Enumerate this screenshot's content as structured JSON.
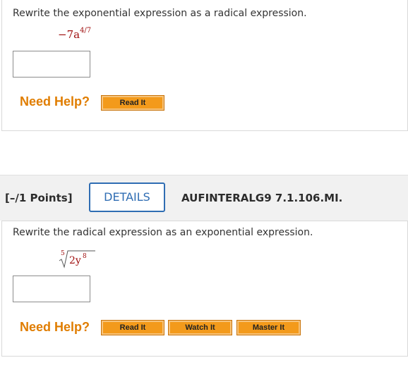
{
  "q1": {
    "prompt": "Rewrite the exponential expression as a radical expression.",
    "expression_base": "−7a",
    "expression_exp": "4/7",
    "need_help": "Need Help?",
    "buttons": [
      "Read It"
    ]
  },
  "q2_header": {
    "points": "[–/1 Points]",
    "details": "DETAILS",
    "code": "AUFINTERALG9 7.1.106.MI."
  },
  "q2": {
    "prompt": "Rewrite the radical expression as an exponential expression.",
    "radical_index": "5",
    "radicand_base": "2y",
    "radicand_exp": "8",
    "need_help": "Need Help?",
    "buttons": [
      "Read It",
      "Watch It",
      "Master It"
    ]
  },
  "colors": {
    "accent_orange": "#e07d00",
    "button_orange": "#f39a1b",
    "details_blue": "#2f6db3",
    "math_red": "#a01010"
  }
}
